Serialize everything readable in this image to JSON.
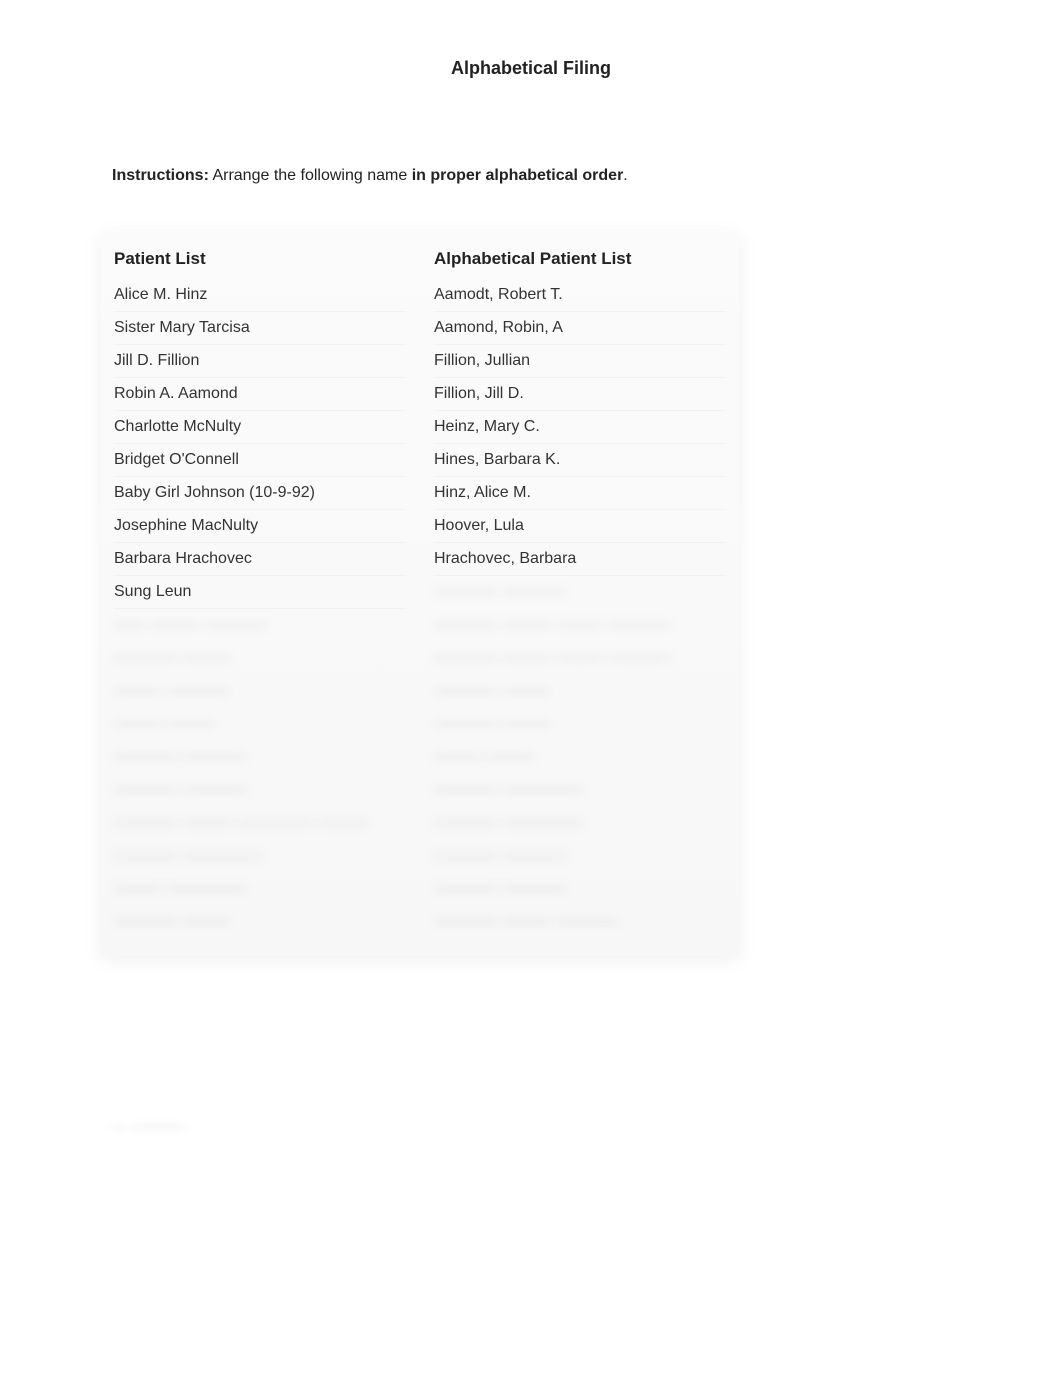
{
  "title": "Alphabetical Filing",
  "instructions": {
    "label": "Instructions:",
    "text_before": "  Arrange the following name ",
    "bold_phrase": "in proper alphabetical order",
    "text_after": "."
  },
  "left": {
    "header": "Patient List",
    "items": [
      "Alice M. Hinz",
      "Sister Mary Tarcisa",
      "Jill D. Fillion",
      "Robin A. Aamond",
      "Charlotte McNulty",
      "Bridget O'Connell",
      "Baby Girl Johnson (10-9-92)",
      "Josephine MacNulty",
      "Barbara Hrachovec",
      "Sung Leun"
    ],
    "blurred_placeholders": [
      "—— ——— ————",
      "———— ———",
      "——— ————",
      "——— ———",
      "———— ————",
      "———— ————",
      "———— ——— ————— ———",
      "———— —————",
      "——— —————",
      "———— ———"
    ]
  },
  "right": {
    "header": "Alphabetical Patient List",
    "items": [
      "Aamodt, Robert T.",
      "Aamond, Robin, A",
      "Fillion, Jullian",
      "Fillion, Jill D.",
      "Heinz, Mary C.",
      "Hines, Barbara K.",
      "Hinz, Alice M.",
      "Hoover, Lula",
      "Hrachovec, Barbara"
    ],
    "blurred_placeholders": [
      "———— ————",
      "———— ——— ——— ————",
      "———— ——— ——— ————",
      "———— ———",
      "———— ———",
      "——— ———",
      "———— —————",
      "———— —————",
      "———— ————",
      "———— ————",
      "———— ——— ————"
    ]
  },
  "footer_blur": "— ————"
}
